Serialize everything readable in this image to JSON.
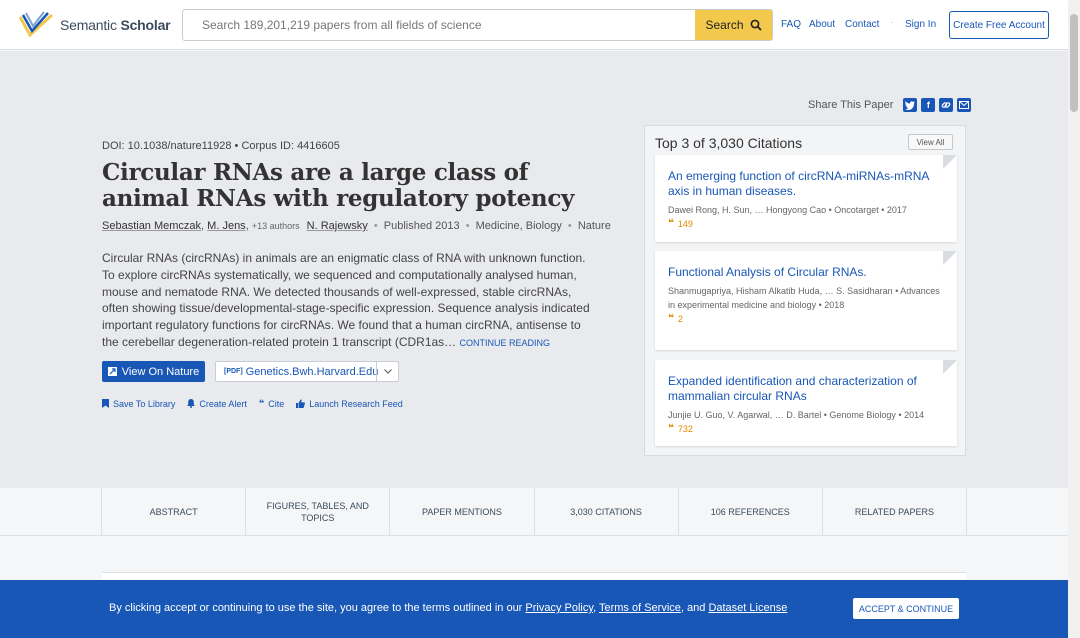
{
  "header": {
    "logo_text_regular": "Semantic ",
    "logo_text_bold": "Scholar",
    "search_placeholder": "Search 189,201,219 papers from all fields of science",
    "search_button": "Search",
    "nav": [
      "FAQ",
      "About",
      "Contact",
      "Sign In"
    ],
    "create_account": "Create Free Account"
  },
  "share": {
    "label": "Share This Paper",
    "icons": [
      "twitter-icon",
      "facebook-icon",
      "link-icon",
      "email-icon"
    ]
  },
  "paper": {
    "doi": "DOI: 10.1038/nature11928",
    "corpus": "Corpus ID: 4416605",
    "title": "Circular RNAs are a large class of animal RNAs with regulatory potency",
    "authors": [
      "Sebastian Memczak",
      "M. Jens"
    ],
    "more_authors": "+13 authors",
    "last_author": "N. Rajewsky",
    "published": "Published 2013",
    "fields": "Medicine, Biology",
    "venue": "Nature",
    "abstract": "Circular RNAs (circRNAs) in animals are an enigmatic class of RNA with unknown function. To explore circRNAs systematically, we sequenced and computationally analysed human, mouse and nematode RNA. We detected thousands of well-expressed, stable circRNAs, often showing tissue/developmental-stage-specific expression. Sequence analysis indicated important regulatory functions for circRNAs. We found that a human circRNA, antisense to the cerebellar degeneration-related protein 1 transcript (CDR1as…",
    "continue_reading": "CONTINUE READING",
    "view_button": "View On Nature",
    "pdf_tag": "[PDF]",
    "pdf_source": "Genetics.Bwh.Harvard.Edu",
    "actions": [
      "Save To Library",
      "Create Alert",
      "Cite",
      "Launch Research Feed"
    ]
  },
  "citations_panel": {
    "heading": "Top 3 of 3,030 Citations",
    "view_all": "View All",
    "items": [
      {
        "title": "An emerging function of circRNA-miRNAs-mRNA axis in human diseases.",
        "meta": "Dawei Rong, H. Sun, … Hongyong Cao  •  Oncotarget  •  2017",
        "count": "149"
      },
      {
        "title": "Functional Analysis of Circular RNAs.",
        "meta": "Shanmugapriya, Hisham Alkatib Huda, … S. Sasidharan  •  Advances in experimental medicine and biology  •  2018",
        "count": "2"
      },
      {
        "title": "Expanded identification and characterization of mammalian circular RNAs",
        "meta": "Junjie U. Guo, V. Agarwal, … D. Bartel  •  Genome Biology  •  2014",
        "count": "732"
      }
    ]
  },
  "tabs": [
    "ABSTRACT",
    "FIGURES, TABLES, AND TOPICS",
    "PAPER MENTIONS",
    "3,030 CITATIONS",
    "106 REFERENCES",
    "RELATED PAPERS"
  ],
  "cookie": {
    "text_prefix": "By clicking accept or continuing to use the site, you agree to the terms outlined in our ",
    "privacy": "Privacy Policy",
    "comma": ", ",
    "terms": "Terms of Service",
    "and": ", and ",
    "dataset": "Dataset License",
    "accept": "ACCEPT & CONTINUE"
  },
  "colors": {
    "brand_blue": "#1857b6",
    "search_yellow": "#f2c94c",
    "citation_orange": "#e08a00"
  }
}
